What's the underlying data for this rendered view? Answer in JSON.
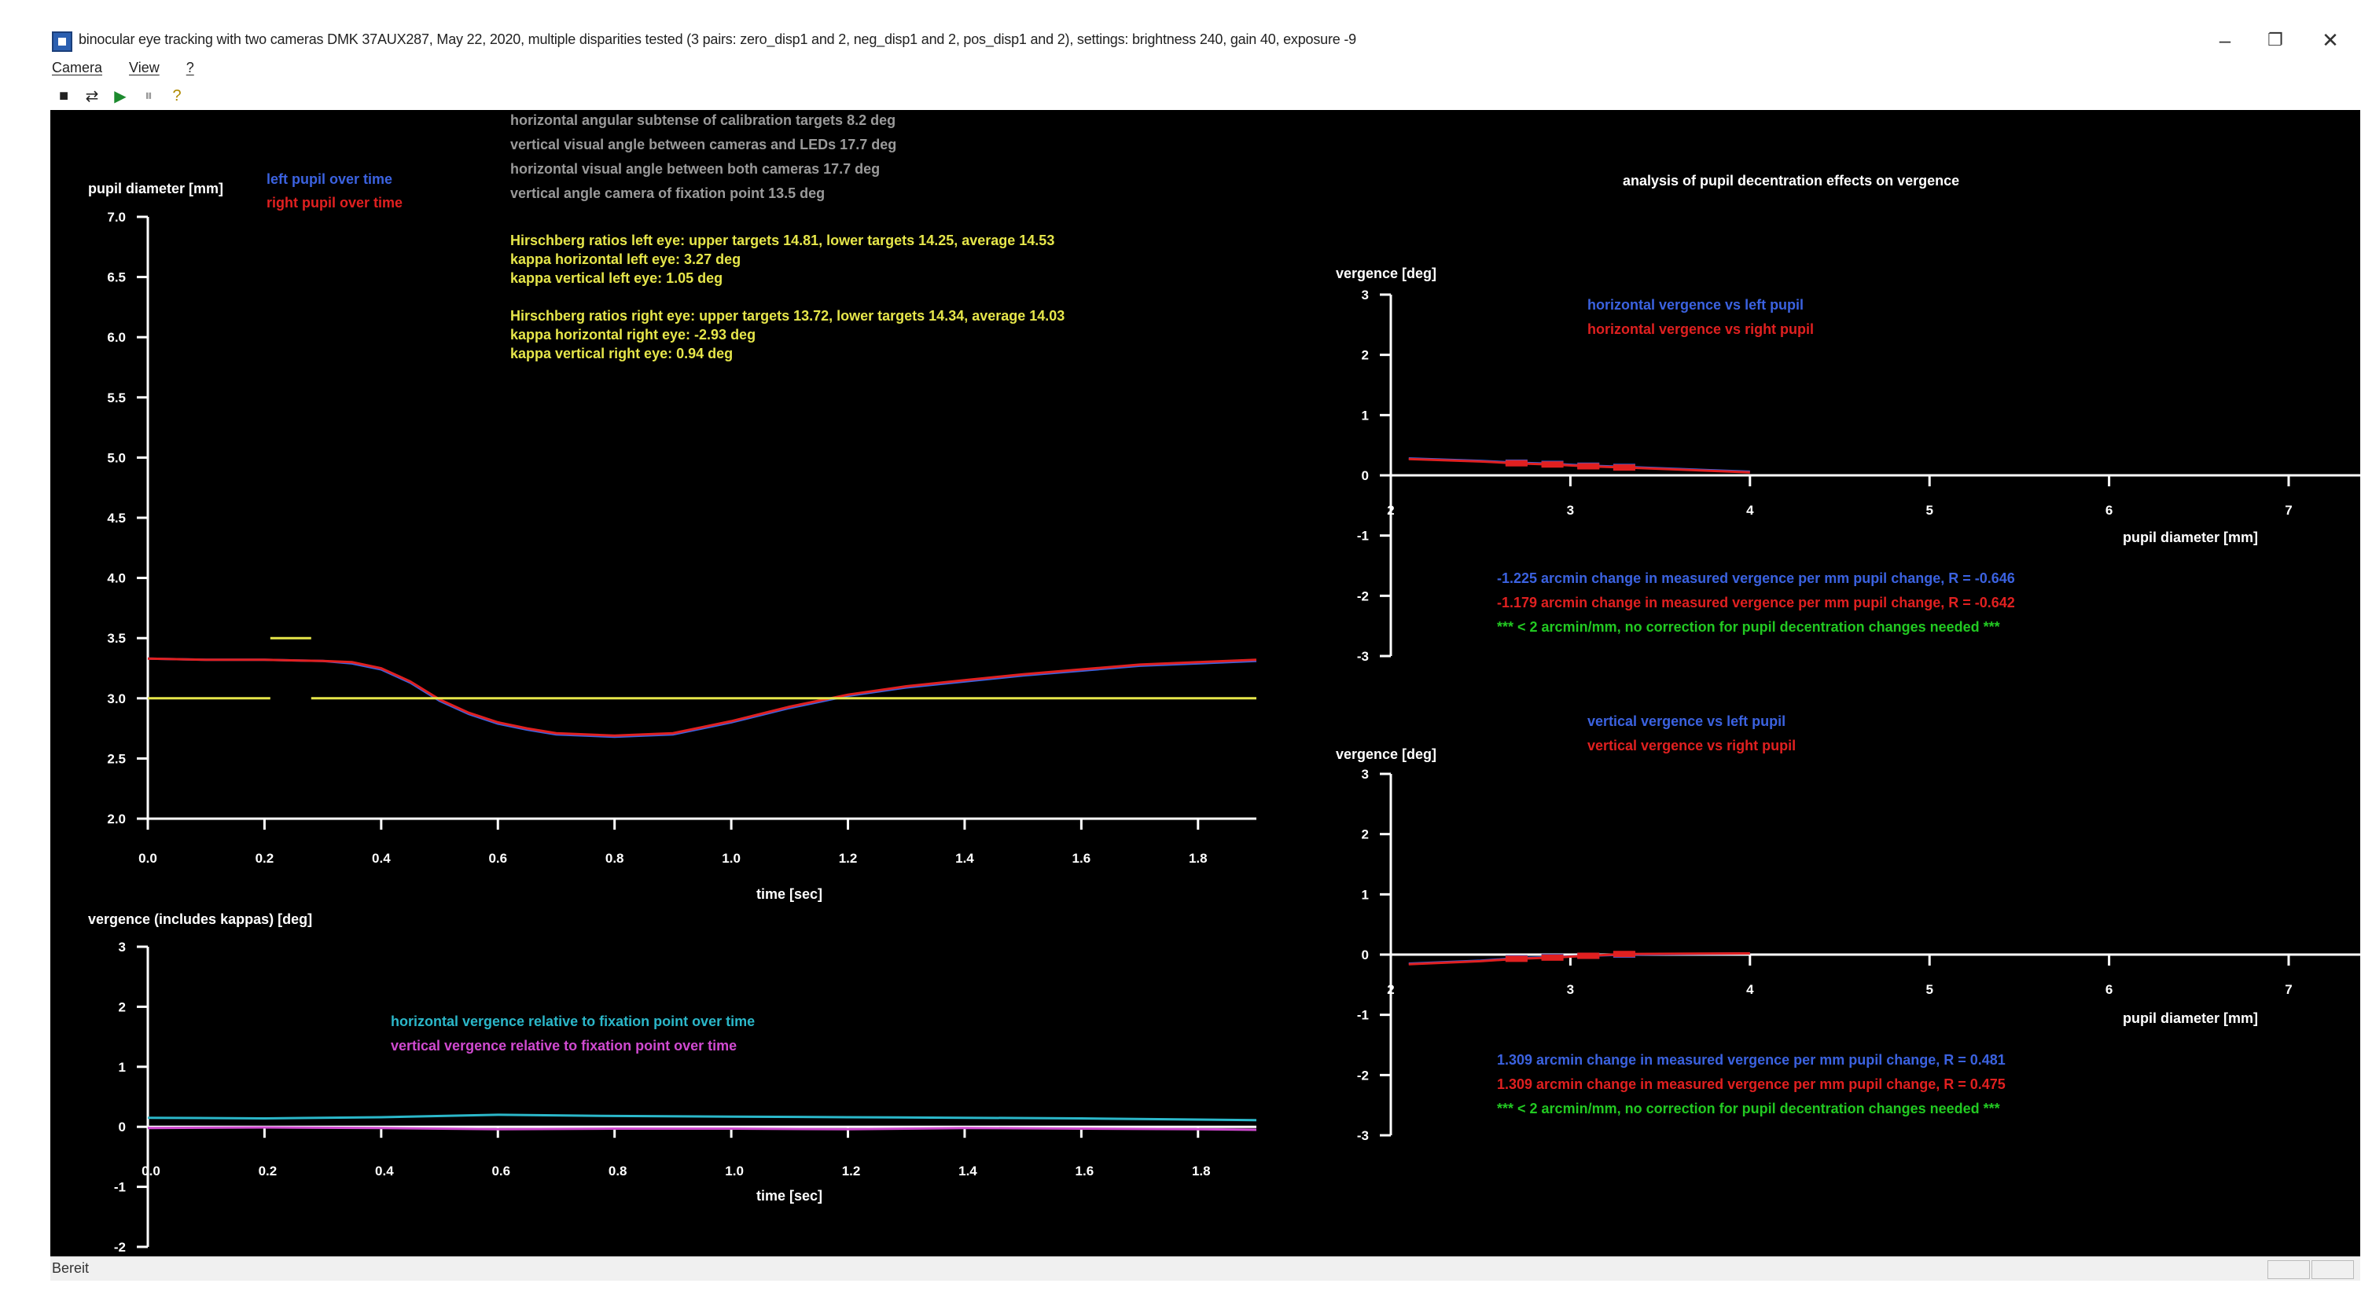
{
  "window": {
    "title": "binocular eye tracking with two cameras DMK 37AUX287, May 22, 2020, multiple disparities tested (3 pairs: zero_disp1 and 2, neg_disp1 and 2, pos_disp1 and 2), settings: brightness 240, gain 40, exposure -9",
    "minimize": "–",
    "restore": "❐",
    "close": "✕"
  },
  "menu": [
    "Camera",
    "View",
    "?"
  ],
  "toolbar": [
    {
      "name": "camera-icon",
      "glyph": "■",
      "color": "#222222"
    },
    {
      "name": "swap-icon",
      "glyph": "⇄",
      "color": "#222222"
    },
    {
      "name": "play-icon",
      "glyph": "▶",
      "color": "#1c8a2e"
    },
    {
      "name": "pause-icon",
      "glyph": "⏸",
      "color": "#9a9a9a"
    },
    {
      "name": "help-icon",
      "glyph": "?",
      "color": "#b08a00"
    }
  ],
  "info_gray": [
    "horizontal angular subtense of calibration targets 8.2 deg",
    "vertical visual angle between cameras and LEDs 17.7 deg",
    "horizontal visual angle between both cameras 17.7 deg",
    "vertical angle camera of fixation point 13.5 deg"
  ],
  "info_left": [
    "Hirschberg ratios left eye: upper targets 14.81, lower targets 14.25, average 14.53",
    "kappa horizontal left eye: 3.27 deg",
    "kappa vertical left eye: 1.05 deg"
  ],
  "info_right": [
    "Hirschberg ratios right eye: upper targets 13.72, lower targets 14.34, average 14.03",
    "kappa horizontal right eye: -2.93 deg",
    "kappa vertical right eye: 0.94 deg"
  ],
  "panel_title": "analysis of pupil decentration effects on vergence",
  "stats_top": [
    "-1.225 arcmin change in measured vergence per mm pupil change, R = -0.646",
    "-1.179 arcmin change in measured vergence per mm pupil change, R = -0.642",
    "*** < 2 arcmin/mm, no correction for pupil decentration changes needed ***"
  ],
  "stats_bottom": [
    "1.309 arcmin change in measured vergence per mm pupil change, R = 0.481",
    "1.309 arcmin change in measured vergence per mm pupil change, R = 0.475",
    "*** < 2 arcmin/mm, no correction for pupil decentration changes needed ***"
  ],
  "colors": {
    "blue": "#3b62e0",
    "red": "#e02020",
    "yellow": "#e6e64a",
    "gray": "#9a9a9a",
    "cyan": "#2bb7c9",
    "magenta": "#d04ad0",
    "green": "#22c922",
    "white": "#ffffff"
  },
  "status": {
    "text": "Bereit"
  },
  "chart_data": [
    {
      "type": "line",
      "ylabel": "pupil diameter [mm]",
      "xlabel": "time [sec]",
      "xlim": [
        0,
        1.9
      ],
      "ylim": [
        2.0,
        7.0
      ],
      "xticks": [
        "0.0",
        "0.2",
        "0.4",
        "0.6",
        "0.8",
        "1.0",
        "1.2",
        "1.4",
        "1.6",
        "1.8"
      ],
      "yticks": [
        "2.0",
        "2.5",
        "3.0",
        "3.5",
        "4.0",
        "4.5",
        "5.0",
        "5.5",
        "6.0",
        "6.5",
        "7.0"
      ],
      "series": [
        {
          "name": "left pupil over time",
          "color": "#3b62e0",
          "x": [
            0.0,
            0.1,
            0.2,
            0.3,
            0.35,
            0.4,
            0.45,
            0.5,
            0.55,
            0.6,
            0.65,
            0.7,
            0.8,
            0.9,
            1.0,
            1.1,
            1.2,
            1.3,
            1.4,
            1.5,
            1.6,
            1.7,
            1.8,
            1.9
          ],
          "y": [
            3.33,
            3.32,
            3.32,
            3.31,
            3.29,
            3.24,
            3.13,
            2.98,
            2.87,
            2.79,
            2.74,
            2.7,
            2.68,
            2.7,
            2.8,
            2.92,
            3.02,
            3.09,
            3.14,
            3.19,
            3.23,
            3.27,
            3.29,
            3.31
          ]
        },
        {
          "name": "right pupil over time",
          "color": "#e02020",
          "x": [
            0.0,
            0.1,
            0.2,
            0.3,
            0.35,
            0.4,
            0.45,
            0.5,
            0.55,
            0.6,
            0.65,
            0.7,
            0.8,
            0.9,
            1.0,
            1.1,
            1.2,
            1.3,
            1.4,
            1.5,
            1.6,
            1.7,
            1.8,
            1.9
          ],
          "y": [
            3.33,
            3.32,
            3.32,
            3.31,
            3.3,
            3.25,
            3.14,
            2.99,
            2.88,
            2.8,
            2.75,
            2.71,
            2.69,
            2.71,
            2.81,
            2.93,
            3.03,
            3.1,
            3.15,
            3.2,
            3.24,
            3.28,
            3.3,
            3.32
          ]
        },
        {
          "color": "#e6e64a",
          "x": [
            0.0,
            0.21
          ],
          "y": [
            3.0,
            3.0
          ]
        },
        {
          "color": "#e6e64a",
          "x": [
            0.28,
            1.9
          ],
          "y": [
            3.0,
            3.0
          ]
        },
        {
          "color": "#e6e64a",
          "x": [
            0.21,
            0.28
          ],
          "y": [
            3.5,
            3.5
          ]
        }
      ]
    },
    {
      "type": "line",
      "ylabel": "vergence (includes kappas) [deg]",
      "xlabel": "time [sec]",
      "xlim": [
        0,
        1.9
      ],
      "ylim": [
        -2,
        3
      ],
      "xticks": [
        "0.0",
        "0.2",
        "0.4",
        "0.6",
        "0.8",
        "1.0",
        "1.2",
        "1.4",
        "1.6",
        "1.8"
      ],
      "yticks": [
        "-2",
        "-1",
        "0",
        "1",
        "2",
        "3"
      ],
      "series": [
        {
          "name": "horizontal vergence relative to fixation point over time",
          "color": "#2bb7c9",
          "x": [
            0.0,
            0.2,
            0.4,
            0.6,
            0.8,
            1.0,
            1.2,
            1.4,
            1.6,
            1.8,
            1.9
          ],
          "y": [
            0.15,
            0.14,
            0.16,
            0.2,
            0.18,
            0.17,
            0.16,
            0.15,
            0.14,
            0.12,
            0.11
          ]
        },
        {
          "name": "vertical vergence relative to fixation point over time",
          "color": "#d04ad0",
          "x": [
            0.0,
            0.2,
            0.4,
            0.6,
            0.8,
            1.0,
            1.2,
            1.4,
            1.6,
            1.8,
            1.9
          ],
          "y": [
            -0.02,
            -0.01,
            -0.02,
            -0.04,
            -0.03,
            -0.03,
            -0.04,
            -0.02,
            -0.03,
            -0.04,
            -0.05
          ]
        }
      ]
    },
    {
      "type": "scatter",
      "ylabel": "vergence [deg]",
      "xlabel": "pupil diameter [mm]",
      "xlim": [
        2,
        7
      ],
      "ylim": [
        -3,
        3
      ],
      "xticks": [
        "2",
        "3",
        "4",
        "5",
        "6",
        "7"
      ],
      "yticks": [
        "-3",
        "-2",
        "-1",
        "0",
        "1",
        "2",
        "3"
      ],
      "series": [
        {
          "name": "horizontal vergence vs left pupil",
          "color": "#3b62e0",
          "x": [
            2.1,
            2.5,
            2.7,
            2.9,
            3.1,
            3.3,
            4.0
          ],
          "y": [
            0.28,
            0.24,
            0.21,
            0.19,
            0.16,
            0.14,
            0.06
          ]
        },
        {
          "name": "horizontal vergence vs right pupil",
          "color": "#e02020",
          "x": [
            2.1,
            2.5,
            2.7,
            2.9,
            3.1,
            3.3,
            4.0
          ],
          "y": [
            0.27,
            0.23,
            0.2,
            0.18,
            0.15,
            0.13,
            0.05
          ]
        }
      ]
    },
    {
      "type": "scatter",
      "ylabel": "vergence [deg]",
      "xlabel": "pupil diameter [mm]",
      "xlim": [
        2,
        7
      ],
      "ylim": [
        -3,
        3
      ],
      "xticks": [
        "2",
        "3",
        "4",
        "5",
        "6",
        "7"
      ],
      "yticks": [
        "-3",
        "-2",
        "-1",
        "0",
        "1",
        "2",
        "3"
      ],
      "series": [
        {
          "name": "vertical vergence vs left pupil",
          "color": "#3b62e0",
          "x": [
            2.1,
            2.5,
            2.7,
            2.9,
            3.1,
            3.3,
            4.0
          ],
          "y": [
            -0.15,
            -0.1,
            -0.06,
            -0.04,
            -0.02,
            0.0,
            0.02
          ]
        },
        {
          "name": "vertical vergence vs right pupil",
          "color": "#e02020",
          "x": [
            2.1,
            2.5,
            2.7,
            2.9,
            3.1,
            3.3,
            4.0
          ],
          "y": [
            -0.16,
            -0.11,
            -0.07,
            -0.05,
            -0.02,
            0.01,
            0.02
          ]
        }
      ]
    }
  ]
}
